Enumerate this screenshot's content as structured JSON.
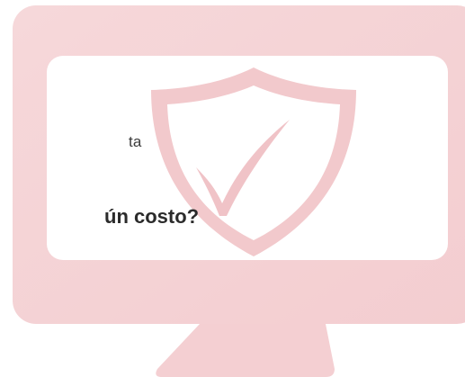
{
  "text_fragments": {
    "line_fragment": "ta",
    "question_fragment": "ún costo?"
  },
  "illustration": {
    "icon": "monitor-shield-check-icon",
    "accent_color": "#e8b4b8",
    "accent_light": "#f7dfe1",
    "background": "#ffffff"
  }
}
